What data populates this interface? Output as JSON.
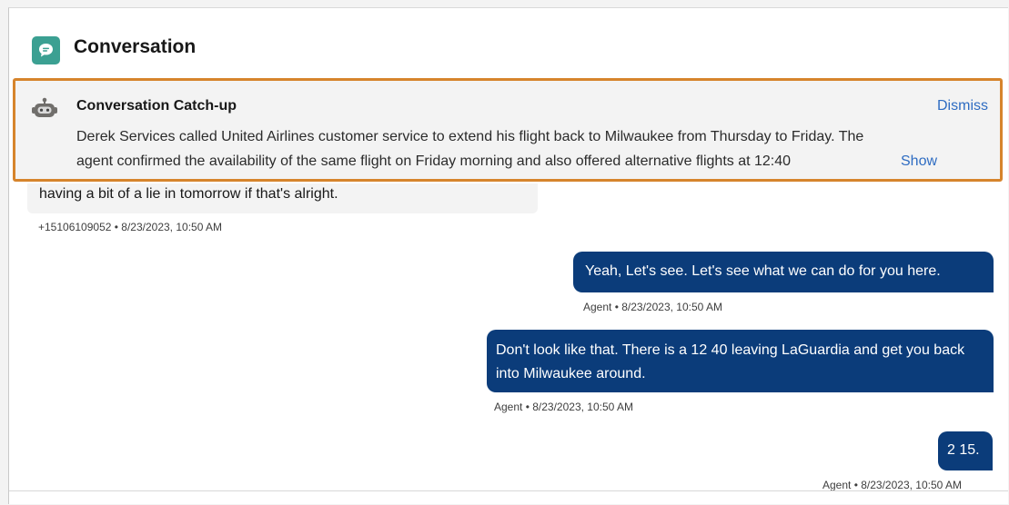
{
  "header": {
    "title": "Conversation",
    "icon": "chat-bubble-icon",
    "icon_bg": "#3ba092"
  },
  "catchup": {
    "icon": "einstein-bot-icon",
    "title": "Conversation Catch-up",
    "dismiss_label": "Dismiss",
    "summary_line1": "Derek Services called United Airlines customer service to extend his flight back to Milwaukee from Thursday to Friday. The",
    "summary_line2": "agent confirmed the availability of the same flight on Friday morning and also offered alternative flights at 12:40",
    "show_more_label": "Show More",
    "highlight_color": "#d6842c"
  },
  "messages": [
    {
      "direction": "inbound",
      "text": "having a bit of a lie in tomorrow if that's alright.",
      "meta": "+15106109052 • 8/23/2023, 10:50 AM"
    },
    {
      "direction": "outbound",
      "text": "Yeah, Let's see. Let's see what we can do for you here.",
      "meta": "Agent • 8/23/2023, 10:50 AM"
    },
    {
      "direction": "outbound",
      "text": "Don't look like that. There is a 12 40 leaving LaGuardia and get you back into Milwaukee around.",
      "meta": "Agent • 8/23/2023, 10:50 AM"
    },
    {
      "direction": "outbound",
      "text": "2 15.",
      "meta": "Agent • 8/23/2023, 10:50 AM"
    }
  ],
  "colors": {
    "agent_bubble": "#0b3c7a",
    "link": "#2e6cc2"
  }
}
